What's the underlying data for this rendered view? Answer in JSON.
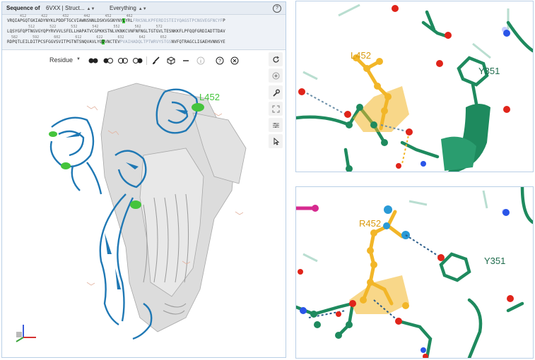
{
  "sequence": {
    "label": "Sequence of",
    "structure_select": "6VXX | Struct...",
    "scope_select": "Everything",
    "lines": [
      {
        "numbers": "      412       422       432       442       452       462",
        "text": "VRQIAPGQTGKIADYNYKLPDDFTGCVIAWNSNNLDSKVGGNYNYLYRLFRKSNLKPFERDISTEIYQAGSTPCNGVEGFNCYFP"
      },
      {
        "numbers": "          512       522       532       542       552       562       572",
        "text": "LQSYGFQPTNGVGYQPYRVVVLSFELLHAPATVCGPKKSTNLVKNKCVNFNFNGLTGTGVLTESNKKFLPFQQFGRDIADTTDAV"
      },
      {
        "numbers": "  582       592       602       612       622       632       642       652",
        "text": "RDPQTLEILDITPCSFGGVSVITPGTNTSNQVAVLYQDVNCTEVPVAIHADQLTPTWRVYSTGSNVFQTRAGCLIGAEHVNNSYE"
      }
    ]
  },
  "toolbar": {
    "label": "Residue"
  },
  "labels": {
    "overview_residue": "L452",
    "top_mutant": "L452",
    "top_partner": "Y351",
    "bottom_mutant": "R452",
    "bottom_partner": "Y351"
  },
  "colors": {
    "chain_blue": "#1f78b4",
    "chain_grey": "#d9d9d9",
    "highlight_green": "#44c43c",
    "residue_gold": "#f2b628",
    "teal_green": "#1e8a5e",
    "oxygen_red": "#e0241a",
    "nitrogen_blue": "#2a55e8"
  },
  "icons": [
    "view-mode-icons",
    "brush-icon",
    "cube-icon",
    "minus-icon",
    "info-icon",
    "help-icon",
    "close-icon",
    "reset-camera-icon",
    "screenshot-icon",
    "wrench-icon",
    "expand-icon",
    "settings-icon",
    "pointer-icon"
  ]
}
